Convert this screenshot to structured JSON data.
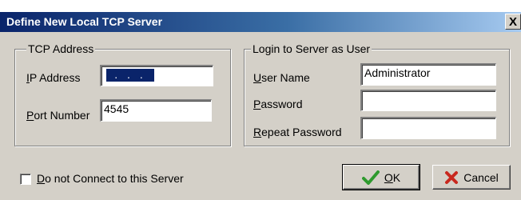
{
  "window": {
    "title": "Define New Local TCP Server",
    "close_glyph": "X"
  },
  "tcp_address": {
    "legend": "TCP Address",
    "ip_label_mnemonic": "I",
    "ip_label_rest": "P Address",
    "ip_value": ". . .",
    "port_label_mnemonic": "P",
    "port_label_rest": "ort Number",
    "port_value": "4545"
  },
  "login": {
    "legend": "Login to Server as User",
    "username_label_mnemonic": "U",
    "username_label_rest": "ser Name",
    "username_value": "Administrator",
    "password_label_mnemonic": "P",
    "password_label_rest": "assword",
    "password_value": "",
    "repeat_label_mnemonic": "R",
    "repeat_label_rest": "epeat Password",
    "repeat_value": ""
  },
  "options": {
    "no_connect_mnemonic": "D",
    "no_connect_rest": "o not Connect to this Server",
    "no_connect_checked": false
  },
  "buttons": {
    "ok_mnemonic": "O",
    "ok_rest": "K",
    "cancel_label": "Cancel"
  },
  "colors": {
    "title_bar": "#0a246a",
    "ok_check": "#2e9a2e",
    "cancel_x": "#c8281e",
    "ip_selection": "#0a246a"
  },
  "icons": {
    "ok": "checkmark-icon",
    "cancel": "red-x-icon",
    "close": "close-icon"
  }
}
